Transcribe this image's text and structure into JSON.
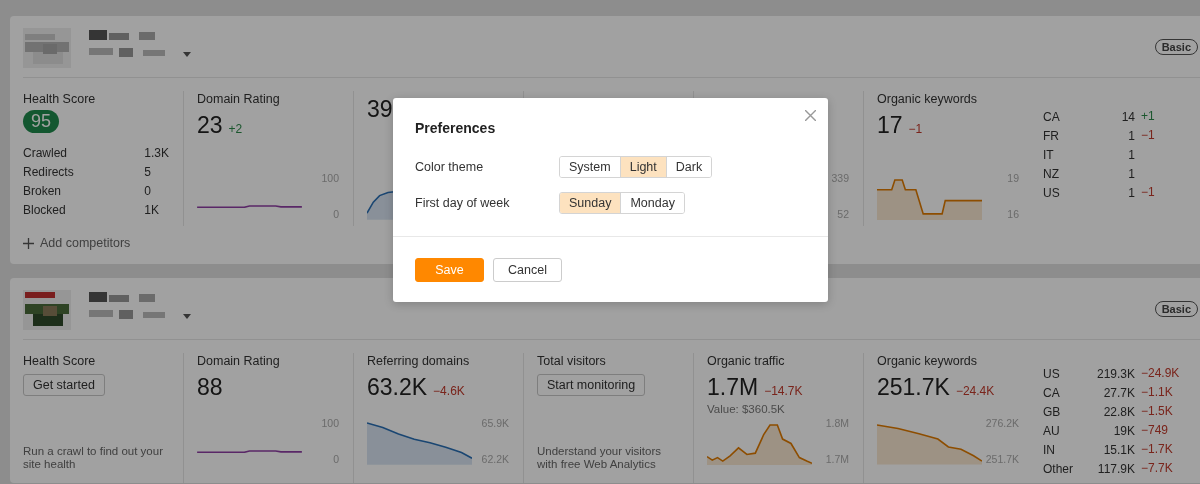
{
  "projects": [
    {
      "plan": "Basic",
      "metrics": [
        {
          "kind": "health",
          "label": "Health Score",
          "score": "95",
          "stats": [
            {
              "label": "Crawled",
              "value": "1.3K"
            },
            {
              "label": "Redirects",
              "value": "5"
            },
            {
              "label": "Broken",
              "value": "0"
            },
            {
              "label": "Blocked",
              "value": "1K"
            }
          ]
        },
        {
          "kind": "rating",
          "label": "Domain Rating",
          "value": "23",
          "change": "+2",
          "increase": true,
          "chart": {
            "kind": "flat",
            "tick_high": "100",
            "tick_low": "0"
          }
        },
        {
          "kind": "domains",
          "value": "39",
          "chart": {
            "kind": "rising"
          }
        },
        {
          "kind": "visitors"
        },
        {
          "kind": "traffic",
          "chart": {
            "tick_high": "339",
            "tick_low": "52"
          }
        },
        {
          "kind": "keywords",
          "label": "Organic keywords",
          "value": "17",
          "change": "−1",
          "increase": false,
          "chart": {
            "kind": "step",
            "tick_high": "19",
            "tick_low": "16"
          }
        }
      ],
      "countries": [
        {
          "code": "CA",
          "value": "14",
          "change": "+1",
          "increase": true
        },
        {
          "code": "FR",
          "value": "1",
          "change": "−1",
          "increase": false
        },
        {
          "code": "IT",
          "value": "1"
        },
        {
          "code": "NZ",
          "value": "1"
        },
        {
          "code": "US",
          "value": "1",
          "change": "−1",
          "increase": false
        }
      ],
      "footer_link": "Add competitors"
    },
    {
      "plan": "Basic",
      "metrics": [
        {
          "kind": "health",
          "label": "Health Score",
          "action": "Get started",
          "note": "Run a crawl to find out your site health"
        },
        {
          "kind": "rating",
          "label": "Domain Rating",
          "value": "88",
          "chart": {
            "kind": "flat",
            "tick_high": "100",
            "tick_low": "0"
          }
        },
        {
          "kind": "domains",
          "label": "Referring domains",
          "value": "63.2K",
          "change": "−4.6K",
          "increase": false,
          "chart": {
            "kind": "falling",
            "tick_high": "65.9K",
            "tick_low": "62.2K"
          }
        },
        {
          "kind": "visitors",
          "label": "Total visitors",
          "action": "Start monitoring",
          "note": "Understand your visitors with free Web Analytics"
        },
        {
          "kind": "traffic",
          "label": "Organic traffic",
          "value": "1.7M",
          "change": "−14.7K",
          "increase": false,
          "sub": "Value: $360.5K",
          "chart": {
            "kind": "peak",
            "tick_high": "1.8M",
            "tick_low": "1.7M"
          }
        },
        {
          "kind": "keywords",
          "label": "Organic keywords",
          "value": "251.7K",
          "change": "−24.4K",
          "increase": false,
          "chart": {
            "kind": "decline",
            "tick_high": "276.2K",
            "tick_low": "251.7K"
          }
        }
      ],
      "countries": [
        {
          "code": "US",
          "value": "219.3K",
          "change": "−24.9K",
          "increase": false
        },
        {
          "code": "CA",
          "value": "27.7K",
          "change": "−1.1K",
          "increase": false
        },
        {
          "code": "GB",
          "value": "22.8K",
          "change": "−1.5K",
          "increase": false
        },
        {
          "code": "AU",
          "value": "19K",
          "change": "−749",
          "increase": false
        },
        {
          "code": "IN",
          "value": "15.1K",
          "change": "−1.7K",
          "increase": false
        },
        {
          "code": "Other",
          "value": "117.9K",
          "change": "−7.7K",
          "increase": false
        }
      ]
    }
  ],
  "preferences_dialog": {
    "title": "Preferences",
    "settings": [
      {
        "label": "Color theme",
        "options": [
          {
            "label": "System",
            "selected": false
          },
          {
            "label": "Light",
            "selected": true
          },
          {
            "label": "Dark",
            "selected": false
          }
        ]
      },
      {
        "label": "First day of week",
        "options": [
          {
            "label": "Sunday",
            "selected": true
          },
          {
            "label": "Monday",
            "selected": false
          }
        ]
      }
    ],
    "buttons": [
      {
        "label": "Save",
        "kind": "primary"
      },
      {
        "label": "Cancel",
        "kind": "secondary"
      }
    ]
  }
}
